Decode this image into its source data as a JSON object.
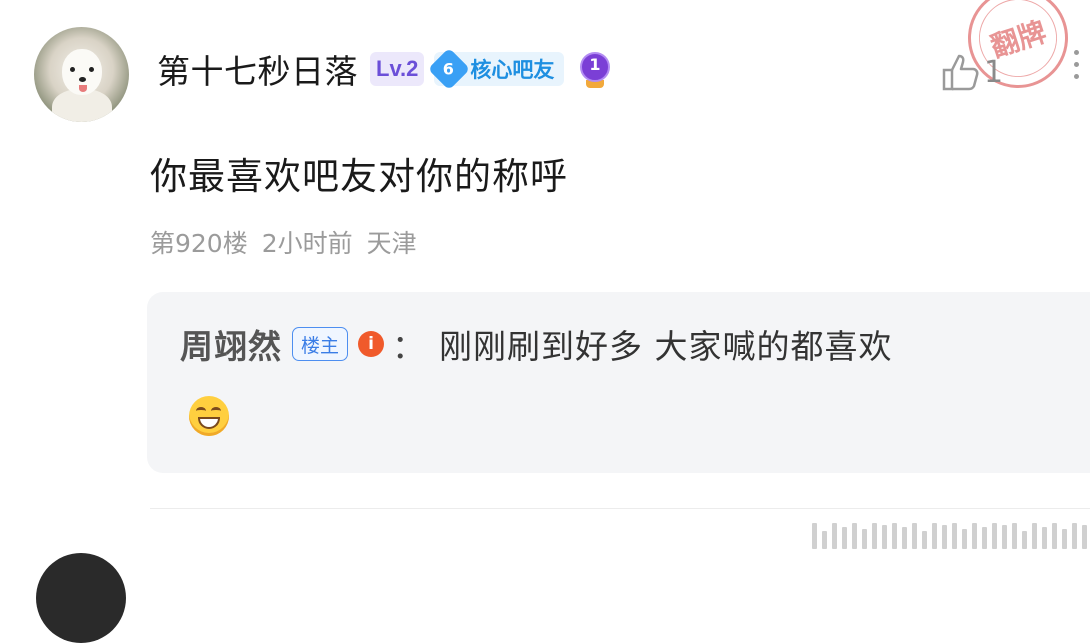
{
  "post": {
    "username": "第十七秒日落",
    "level_badge": "Lv.2",
    "core_badge_number": "6",
    "core_badge_label": "核心吧友",
    "medal_number": "1",
    "like_count": "1",
    "stamp_text": "翻牌",
    "content": "你最喜欢吧友对你的称呼",
    "floor": "第920楼",
    "time": "2小时前",
    "location": "天津"
  },
  "reply": {
    "name": "周翊然",
    "owner_badge": "楼主",
    "info_icon_char": "i",
    "colon": "：",
    "text": "刚刚刷到好多 大家喊的都喜欢"
  },
  "colors": {
    "level_badge": "#6b4fd8",
    "core_badge": "#1e8fe1",
    "owner_badge": "#3a7de6",
    "stamp": "#d63c3c"
  },
  "icons": [
    "avatar",
    "medal-icon",
    "like-icon",
    "more-icon",
    "info-icon",
    "grin-emoji-icon",
    "stamp"
  ]
}
